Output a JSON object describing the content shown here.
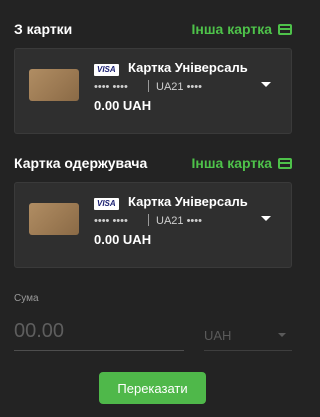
{
  "source_card": {
    "section_title": "З картки",
    "other_card_label": "Інша картка",
    "network": "VISA",
    "name": "Картка Універсаль",
    "masked_number": "•••• ••••",
    "iban": "UA21 ••••",
    "balance": "0.00 UAH"
  },
  "recipient_card": {
    "section_title": "Картка одержувача",
    "other_card_label": "Інша картка",
    "network": "VISA",
    "name": "Картка Універсаль",
    "masked_number": "•••• ••••",
    "iban": "UA21 ••••",
    "balance": "0.00 UAH"
  },
  "amount": {
    "label": "Сума",
    "value": "",
    "placeholder": "00.00",
    "currency": "UAH"
  },
  "submit_label": "Переказати",
  "colors": {
    "background": "#232323",
    "card_bg": "#2f2f2f",
    "accent": "#4ec24a",
    "button": "#4fb84a"
  }
}
